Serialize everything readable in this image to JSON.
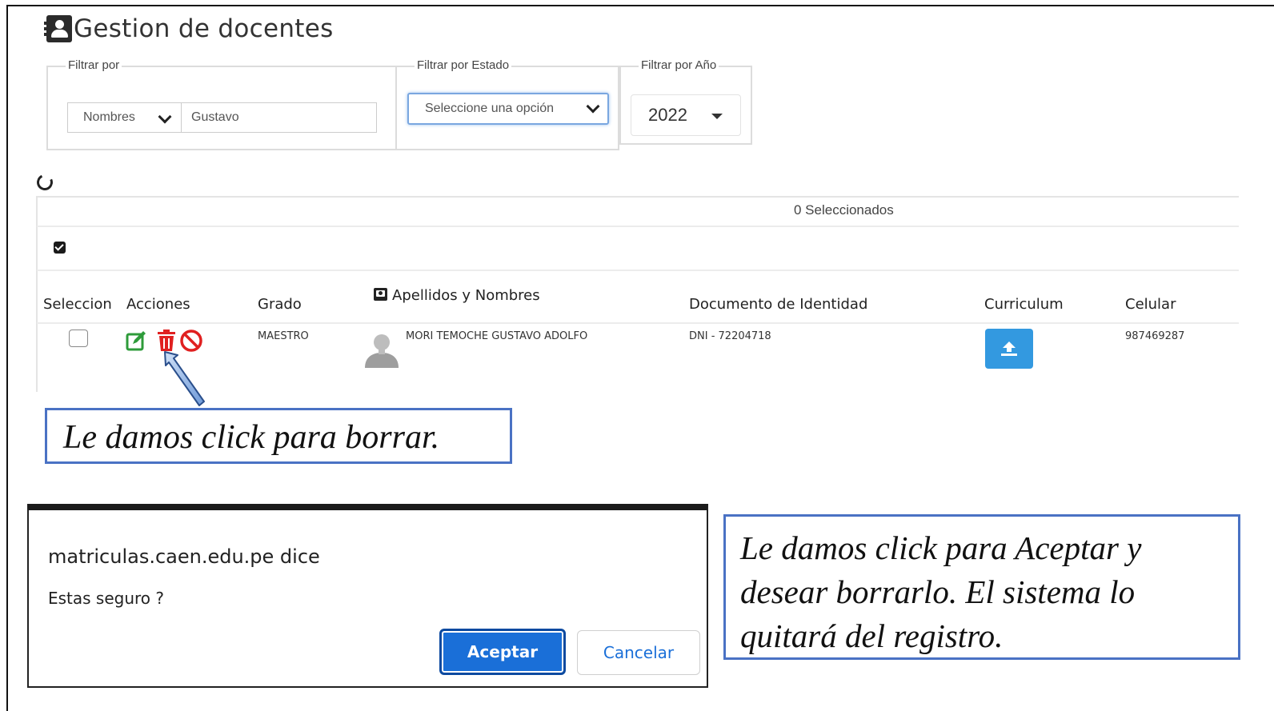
{
  "header": {
    "title": "Gestion de docentes"
  },
  "filters": {
    "filtrar_por": {
      "legend": "Filtrar por",
      "field": "Nombres",
      "value": "Gustavo"
    },
    "estado": {
      "legend": "Filtrar por Estado",
      "placeholder": "Seleccione una opción"
    },
    "anio": {
      "legend": "Filtrar por Año",
      "value": "2022"
    }
  },
  "table": {
    "selected_count": "0 Seleccionados",
    "headers": {
      "seleccion": "Seleccion",
      "acciones": "Acciones",
      "grado": "Grado",
      "nombres": "Apellidos y Nombres",
      "documento": "Documento de Identidad",
      "curriculum": "Curriculum",
      "celular": "Celular"
    },
    "rows": [
      {
        "grado": "MAESTRO",
        "nombre": "MORI TEMOCHE GUSTAVO ADOLFO",
        "documento": "DNI - 72204718",
        "celular": "987469287"
      }
    ],
    "action_icons": [
      "edit-icon",
      "trash-icon",
      "ban-icon"
    ]
  },
  "annotations": {
    "note1": "Le damos click para borrar.",
    "note2_lines": [
      "Le damos click para Aceptar y",
      "desear borrarlo. El sistema lo",
      "quitará del registro."
    ]
  },
  "dialog": {
    "title": "matriculas.caen.edu.pe dice",
    "message": "Estas seguro ?",
    "accept_label": "Aceptar",
    "cancel_label": "Cancelar"
  },
  "colors": {
    "primary_blue": "#1a6fd8",
    "upload_blue": "#3399e0",
    "edit_green": "#2e9b3a",
    "delete_red": "#e02020",
    "annotation_border": "#4a72c4"
  }
}
